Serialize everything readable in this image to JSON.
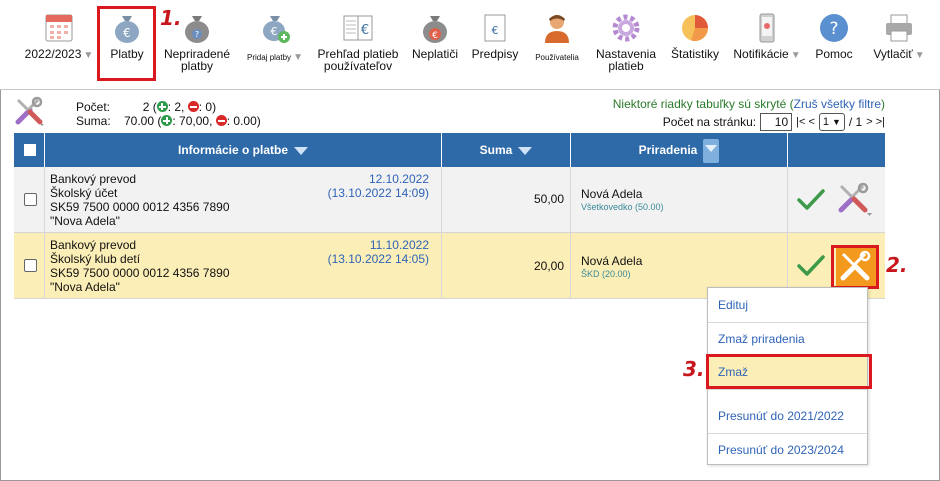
{
  "toolbar": {
    "items": [
      {
        "label": "2022/2023",
        "icon": "calendar-icon",
        "arrow": "▼"
      },
      {
        "label": "Platby",
        "icon": "money-bag-icon"
      },
      {
        "label": "Nepriradené",
        "label2": "platby",
        "icon": "money-bag-question-icon"
      },
      {
        "label": "Pridaj platby",
        "icon": "money-bag-add-icon",
        "arrow": "▼"
      },
      {
        "label": "Prehľad platieb",
        "label2": "používateľov",
        "icon": "ledger-euro-icon"
      },
      {
        "label": "Neplatiči",
        "icon": "money-bag-alert-icon"
      },
      {
        "label": "Predpisy",
        "icon": "document-euro-icon"
      },
      {
        "label": "Používatelia",
        "icon": "user-icon"
      },
      {
        "label": "Nastavenia",
        "label2": "platieb",
        "icon": "gear-icon"
      },
      {
        "label": "Štatistiky",
        "icon": "pie-chart-icon"
      },
      {
        "label": "Notifikácie",
        "icon": "phone-icon",
        "arrow": "▼"
      },
      {
        "label": "Pomoc",
        "icon": "help-icon"
      },
      {
        "label": "Vytlačiť",
        "icon": "printer-icon",
        "arrow": "▼"
      }
    ]
  },
  "steps": {
    "s1": "1.",
    "s2": "2.",
    "s3": "3."
  },
  "summary": {
    "count_label": "Počet:",
    "count_value": "2",
    "count_plus": ": 2,",
    "count_minus": ": 0)",
    "sum_label": "Suma:",
    "sum_value": "70.00",
    "sum_plus": ": 70,00,",
    "sum_minus": ": 0.00)",
    "open_paren": "("
  },
  "filters_note": {
    "text": "Niektoré riadky tabuľky sú skryté",
    "link": "Zruš všetky filtre"
  },
  "pagination": {
    "label": "Počet na stránku:",
    "per_page": "10",
    "first_prev": "|< <",
    "page": "1",
    "of": "/ 1",
    "next_last": "> >|"
  },
  "table": {
    "headers": {
      "info": "Informácie o platbe",
      "sum": "Suma",
      "assign": "Priradenia"
    },
    "rows": [
      {
        "type": "Bankový prevod",
        "account_name": "Školský účet",
        "iban": "SK59 7500 0000 0012 4356 7890",
        "payer": "\"Nova Adela\"",
        "date": "12.10.2022",
        "date_time": "(13.10.2022 14:09)",
        "amount": "50,00",
        "assign_name": "Nová Adela",
        "assign_sub": "Všetkovedko (50.00)"
      },
      {
        "type": "Bankový prevod",
        "account_name": "Školský klub detí",
        "iban": "SK59 7500 0000 0012 4356 7890",
        "payer": "\"Nova Adela\"",
        "date": "11.10.2022",
        "date_time": "(13.10.2022 14:05)",
        "amount": "20,00",
        "assign_name": "Nová Adela",
        "assign_sub": "ŠKD (20.00)"
      }
    ]
  },
  "menu": {
    "items": [
      "Edituj",
      "Zmaž priradenia",
      "Zmaž",
      "Presunúť do 2021/2022",
      "Presunúť do 2023/2024"
    ]
  },
  "colors": {
    "header": "#2e6aa8",
    "highlight": "#fbeeb6",
    "annotation": "#d9191f",
    "link": "#2f63b8"
  }
}
